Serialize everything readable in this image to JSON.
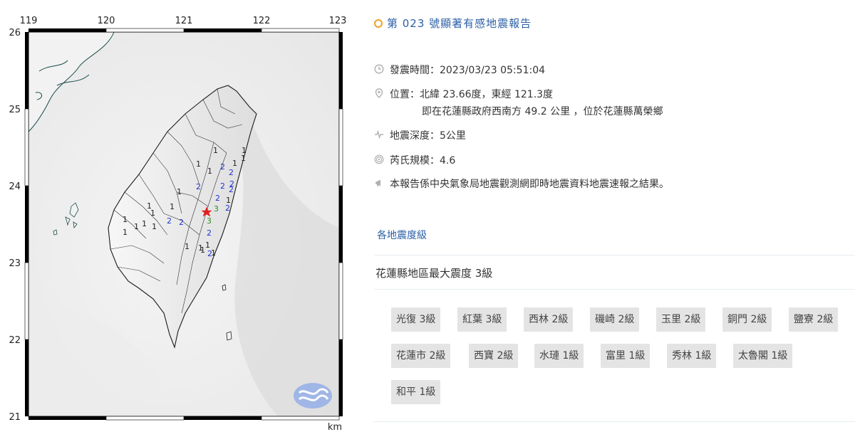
{
  "map": {
    "lon_ticks": [
      "119",
      "120",
      "121",
      "122",
      "123"
    ],
    "lat_ticks": [
      "26",
      "25",
      "24",
      "23",
      "22",
      "21"
    ],
    "unit_label": "km",
    "intensity_marks": [
      {
        "v": "1",
        "c": "#222"
      },
      {
        "v": "1",
        "c": "#222"
      },
      {
        "v": "1",
        "c": "#222"
      },
      {
        "v": "1",
        "c": "#222"
      },
      {
        "v": "1",
        "c": "#222"
      },
      {
        "v": "1",
        "c": "#222"
      },
      {
        "v": "1",
        "c": "#222"
      },
      {
        "v": "1",
        "c": "#222"
      },
      {
        "v": "1",
        "c": "#222"
      },
      {
        "v": "1",
        "c": "#222"
      },
      {
        "v": "1",
        "c": "#222"
      },
      {
        "v": "1",
        "c": "#222"
      },
      {
        "v": "1",
        "c": "#222"
      },
      {
        "v": "1",
        "c": "#222"
      },
      {
        "v": "1",
        "c": "#222"
      },
      {
        "v": "1",
        "c": "#222"
      },
      {
        "v": "1",
        "c": "#222"
      },
      {
        "v": "1",
        "c": "#222"
      },
      {
        "v": "1",
        "c": "#222"
      },
      {
        "v": "1",
        "c": "#222"
      },
      {
        "v": "1",
        "c": "#222"
      },
      {
        "v": "2",
        "c": "#2233cc"
      },
      {
        "v": "2",
        "c": "#2233cc"
      },
      {
        "v": "2",
        "c": "#2233cc"
      },
      {
        "v": "2",
        "c": "#2233cc"
      },
      {
        "v": "2",
        "c": "#2233cc"
      },
      {
        "v": "2",
        "c": "#2233cc"
      },
      {
        "v": "2",
        "c": "#2233cc"
      },
      {
        "v": "2",
        "c": "#2233cc"
      },
      {
        "v": "2",
        "c": "#2233cc"
      },
      {
        "v": "2",
        "c": "#2233cc"
      },
      {
        "v": "2",
        "c": "#2233cc"
      },
      {
        "v": "2",
        "c": "#2233cc"
      },
      {
        "v": "3",
        "c": "#2a8a2a"
      },
      {
        "v": "3",
        "c": "#2a8a2a"
      }
    ],
    "epicenter_color": "#e02020",
    "logo": "cwb-logo"
  },
  "report": {
    "title": "第 023 號顯著有感地震報告",
    "time": "發震時間：2023/03/23 05:51:04",
    "location_line1": "位置：北緯 23.66度，東經 121.3度",
    "location_line2": "即在花蓮縣政府西南方 49.2 公里 ，位於花蓮縣萬榮鄉",
    "depth": "地震深度：5公里",
    "magnitude": "芮氏規模：4.6",
    "note": "本報告係中央氣象局地震觀測網即時地震資料地震速報之結果。",
    "section_link": "各地震度級",
    "max_intensity": "花蓮縣地區最大震度 3級",
    "stations": [
      "光復 3級",
      "紅葉 3級",
      "西林 2級",
      "磯崎 2級",
      "玉里 2級",
      "銅門 2級",
      "鹽寮 2級",
      "花蓮市 2級",
      "西寶 2級",
      "水璉 1級",
      "富里 1級",
      "秀林 1級",
      "太魯閣 1級",
      "和平 1級"
    ]
  },
  "colors": {
    "title_link": "#2b5fa6",
    "title_ring": "#f0a020",
    "tag_bg": "#e4e4e4",
    "icon": "#b0b0b0"
  }
}
